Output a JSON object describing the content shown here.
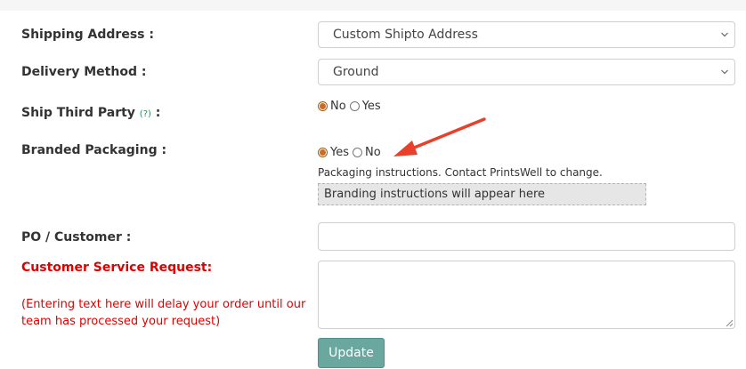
{
  "form": {
    "shipping_address": {
      "label": "Shipping Address :",
      "selected": "Custom Shipto Address"
    },
    "delivery_method": {
      "label": "Delivery Method :",
      "selected": "Ground"
    },
    "ship_third_party": {
      "label": "Ship Third Party",
      "help": "(?)",
      "colon": ":",
      "options": [
        "No",
        "Yes"
      ],
      "selected": "No"
    },
    "branded_packaging": {
      "label": "Branded Packaging :",
      "options": [
        "Yes",
        "No"
      ],
      "selected": "Yes",
      "instructions_label": "Packaging instructions. Contact PrintsWell to change.",
      "instructions_box": "Branding instructions will appear here"
    },
    "po_customer": {
      "label": "PO / Customer :",
      "value": "",
      "placeholder": ""
    },
    "customer_service_request": {
      "label": "Customer Service Request:",
      "note": "(Entering text here will delay your order until our team has processed your request)",
      "value": ""
    },
    "update_button": "Update"
  },
  "colors": {
    "accent_radio": "#d2691e",
    "button": "#6aa89f",
    "warning_text": "#e00000",
    "annotation_arrow": "#e8402a",
    "help_link": "#2e8b57"
  },
  "annotation": {
    "arrow_icon": "red-arrow-icon"
  }
}
